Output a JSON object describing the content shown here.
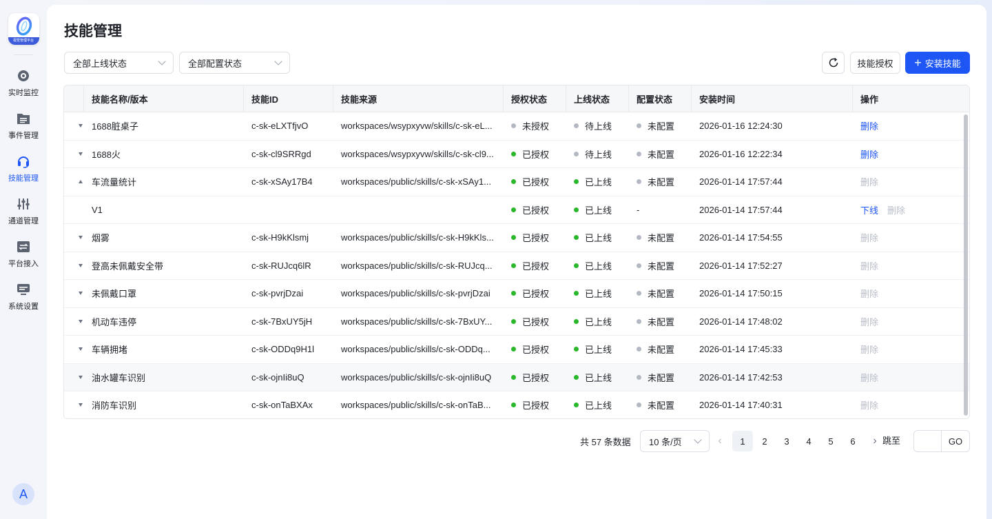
{
  "app": {
    "logo_caption": "视觉管理平台",
    "avatar_letter": "A"
  },
  "sidebar": {
    "items": [
      {
        "label": "实时监控",
        "icon": "camera-icon",
        "active": false
      },
      {
        "label": "事件管理",
        "icon": "folder-list-icon",
        "active": false
      },
      {
        "label": "技能管理",
        "icon": "headset-icon",
        "active": true
      },
      {
        "label": "通道管理",
        "icon": "sliders-icon",
        "active": false
      },
      {
        "label": "平台接入",
        "icon": "transfer-icon",
        "active": false
      },
      {
        "label": "系统设置",
        "icon": "server-icon",
        "active": false
      }
    ]
  },
  "page": {
    "title": "技能管理"
  },
  "filters": {
    "online_status": "全部上线状态",
    "config_status": "全部配置状态"
  },
  "toolbar": {
    "refresh_icon": "refresh-icon",
    "authorize_label": "技能授权",
    "install_label": "安装技能"
  },
  "table": {
    "columns": [
      "技能名称/版本",
      "技能ID",
      "技能来源",
      "授权状态",
      "上线状态",
      "配置状态",
      "安装时间",
      "操作"
    ],
    "rows": [
      {
        "name": "1688脏桌子",
        "id": "c-sk-eLXTfjvO",
        "source": "workspaces/wsypxyvw/skills/c-sk-eL...",
        "auth": "未授权",
        "auth_color": "gray",
        "online": "待上线",
        "online_color": "gray",
        "config": "未配置",
        "config_color": "gray",
        "time": "2026-01-16 12:24:30",
        "actions": [
          {
            "label": "删除",
            "enabled": true
          }
        ],
        "expander": "down"
      },
      {
        "name": "1688火",
        "id": "c-sk-cl9SRRgd",
        "source": "workspaces/wsypxyvw/skills/c-sk-cl9...",
        "auth": "已授权",
        "auth_color": "green",
        "online": "待上线",
        "online_color": "gray",
        "config": "未配置",
        "config_color": "gray",
        "time": "2026-01-16 12:22:34",
        "actions": [
          {
            "label": "删除",
            "enabled": true
          }
        ],
        "expander": "down"
      },
      {
        "name": "车流量统计",
        "id": "c-sk-xSAy17B4",
        "source": "workspaces/public/skills/c-sk-xSAy1...",
        "auth": "已授权",
        "auth_color": "green",
        "online": "已上线",
        "online_color": "green",
        "config": "未配置",
        "config_color": "gray",
        "time": "2026-01-14 17:57:44",
        "actions": [
          {
            "label": "删除",
            "enabled": false
          }
        ],
        "expander": "up"
      },
      {
        "name": "V1",
        "id": "",
        "source": "",
        "auth": "已授权",
        "auth_color": "green",
        "online": "已上线",
        "online_color": "green",
        "config": "-",
        "config_color": "",
        "time": "2026-01-14 17:57:44",
        "actions": [
          {
            "label": "下线",
            "enabled": true
          },
          {
            "label": "删除",
            "enabled": false
          }
        ],
        "expander": "",
        "child": true
      },
      {
        "name": "烟雾",
        "id": "c-sk-H9kKlsmj",
        "source": "workspaces/public/skills/c-sk-H9kKls...",
        "auth": "已授权",
        "auth_color": "green",
        "online": "已上线",
        "online_color": "green",
        "config": "未配置",
        "config_color": "gray",
        "time": "2026-01-14 17:54:55",
        "actions": [
          {
            "label": "删除",
            "enabled": false
          }
        ],
        "expander": "down"
      },
      {
        "name": "登高未佩戴安全带",
        "id": "c-sk-RUJcq6lR",
        "source": "workspaces/public/skills/c-sk-RUJcq...",
        "auth": "已授权",
        "auth_color": "green",
        "online": "已上线",
        "online_color": "green",
        "config": "未配置",
        "config_color": "gray",
        "time": "2026-01-14 17:52:27",
        "actions": [
          {
            "label": "删除",
            "enabled": false
          }
        ],
        "expander": "down"
      },
      {
        "name": "未佩戴口罩",
        "id": "c-sk-pvrjDzai",
        "source": "workspaces/public/skills/c-sk-pvrjDzai",
        "auth": "已授权",
        "auth_color": "green",
        "online": "已上线",
        "online_color": "green",
        "config": "未配置",
        "config_color": "gray",
        "time": "2026-01-14 17:50:15",
        "actions": [
          {
            "label": "删除",
            "enabled": false
          }
        ],
        "expander": "down"
      },
      {
        "name": "机动车违停",
        "id": "c-sk-7BxUY5jH",
        "source": "workspaces/public/skills/c-sk-7BxUY...",
        "auth": "已授权",
        "auth_color": "green",
        "online": "已上线",
        "online_color": "green",
        "config": "未配置",
        "config_color": "gray",
        "time": "2026-01-14 17:48:02",
        "actions": [
          {
            "label": "删除",
            "enabled": false
          }
        ],
        "expander": "down"
      },
      {
        "name": "车辆拥堵",
        "id": "c-sk-ODDq9H1l",
        "source": "workspaces/public/skills/c-sk-ODDq...",
        "auth": "已授权",
        "auth_color": "green",
        "online": "已上线",
        "online_color": "green",
        "config": "未配置",
        "config_color": "gray",
        "time": "2026-01-14 17:45:33",
        "actions": [
          {
            "label": "删除",
            "enabled": false
          }
        ],
        "expander": "down"
      },
      {
        "name": "油水罐车识别",
        "id": "c-sk-ojnIi8uQ",
        "source": "workspaces/public/skills/c-sk-ojnIi8uQ",
        "auth": "已授权",
        "auth_color": "green",
        "online": "已上线",
        "online_color": "green",
        "config": "未配置",
        "config_color": "gray",
        "time": "2026-01-14 17:42:53",
        "actions": [
          {
            "label": "删除",
            "enabled": false
          }
        ],
        "expander": "down",
        "hover": true
      },
      {
        "name": "消防车识别",
        "id": "c-sk-onTaBXAx",
        "source": "workspaces/public/skills/c-sk-onTaB...",
        "auth": "已授权",
        "auth_color": "green",
        "online": "已上线",
        "online_color": "green",
        "config": "未配置",
        "config_color": "gray",
        "time": "2026-01-14 17:40:31",
        "actions": [
          {
            "label": "删除",
            "enabled": false
          }
        ],
        "expander": "down"
      }
    ]
  },
  "pagination": {
    "total_text": "共 57 条数据",
    "page_size": "10 条/页",
    "pages": [
      "1",
      "2",
      "3",
      "4",
      "5",
      "6"
    ],
    "current": "1",
    "jump_label": "跳至",
    "go_label": "GO"
  }
}
